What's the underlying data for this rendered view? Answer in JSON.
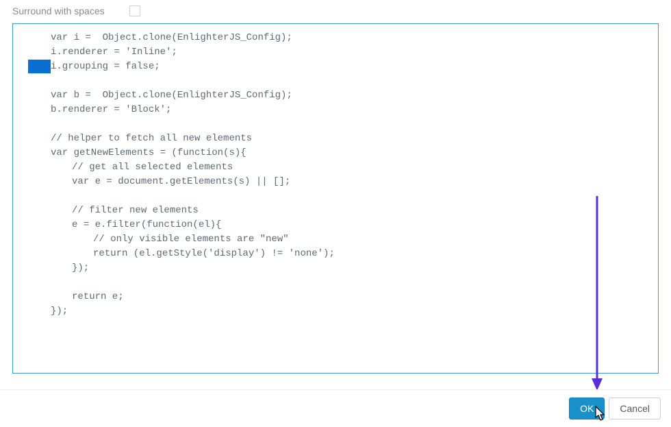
{
  "option": {
    "surround_label": "Surround with spaces",
    "checked": false
  },
  "code": {
    "lines": [
      {
        "indent": 0,
        "text": "var i =  Object.clone(EnlighterJS_Config);",
        "selected": false
      },
      {
        "indent": 0,
        "text": "i.renderer = 'Inline';",
        "selected": false
      },
      {
        "indent": 0,
        "text": "i.grouping = false;",
        "selected": true
      },
      {
        "indent": 0,
        "text": "",
        "selected": false
      },
      {
        "indent": 0,
        "text": "var b =  Object.clone(EnlighterJS_Config);",
        "selected": false
      },
      {
        "indent": 0,
        "text": "b.renderer = 'Block';",
        "selected": false
      },
      {
        "indent": 0,
        "text": "",
        "selected": false
      },
      {
        "indent": 0,
        "text": "// helper to fetch all new elements",
        "selected": false
      },
      {
        "indent": 0,
        "text": "var getNewElements = (function(s){",
        "selected": false
      },
      {
        "indent": 1,
        "text": "// get all selected elements",
        "selected": false
      },
      {
        "indent": 1,
        "text": "var e = document.getElements(s) || [];",
        "selected": false
      },
      {
        "indent": 1,
        "text": "",
        "selected": false
      },
      {
        "indent": 1,
        "text": "// filter new elements",
        "selected": false
      },
      {
        "indent": 1,
        "text": "e = e.filter(function(el){",
        "selected": false
      },
      {
        "indent": 2,
        "text": "// only visible elements are \"new\"",
        "selected": false
      },
      {
        "indent": 2,
        "text": "return (el.getStyle('display') != 'none');",
        "selected": false
      },
      {
        "indent": 1,
        "text": "});",
        "selected": false
      },
      {
        "indent": 1,
        "text": "",
        "selected": false
      },
      {
        "indent": 1,
        "text": "return e;",
        "selected": false
      },
      {
        "indent": 0,
        "text": "});",
        "selected": false
      }
    ]
  },
  "buttons": {
    "ok_label": "OK",
    "cancel_label": "Cancel"
  },
  "annotation": {
    "arrow_color": "#5a2fd6"
  }
}
